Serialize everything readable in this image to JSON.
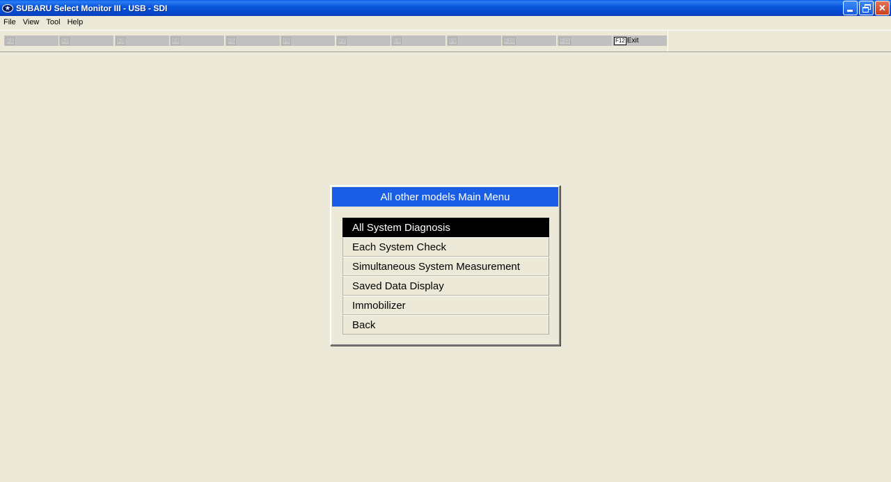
{
  "window": {
    "title": "SUBARU Select Monitor III - USB - SDI",
    "app_icon": "subaru-logo-icon",
    "controls": {
      "minimize_icon": "minimize-icon",
      "restore_icon": "restore-icon",
      "close_icon": "close-icon",
      "close_glyph": "✕"
    }
  },
  "menubar": {
    "items": [
      "File",
      "View",
      "Tool",
      "Help"
    ]
  },
  "toolbar": {
    "fkeys": [
      {
        "key": "F1",
        "label": ""
      },
      {
        "key": "F2",
        "label": ""
      },
      {
        "key": "F3",
        "label": ""
      },
      {
        "key": "F4",
        "label": ""
      },
      {
        "key": "F5",
        "label": ""
      },
      {
        "key": "F6",
        "label": ""
      },
      {
        "key": "F7",
        "label": ""
      },
      {
        "key": "F8",
        "label": ""
      },
      {
        "key": "F9",
        "label": ""
      },
      {
        "key": "F10",
        "label": ""
      },
      {
        "key": "F11",
        "label": ""
      },
      {
        "key": "F12",
        "label": "Exit"
      }
    ]
  },
  "dialog": {
    "title": "All other models Main Menu",
    "items": [
      {
        "label": "All System Diagnosis",
        "selected": true
      },
      {
        "label": "Each System Check",
        "selected": false
      },
      {
        "label": "Simultaneous System Measurement",
        "selected": false
      },
      {
        "label": "Saved Data Display",
        "selected": false
      },
      {
        "label": "Immobilizer",
        "selected": false
      },
      {
        "label": "Back",
        "selected": false
      }
    ]
  },
  "colors": {
    "titlebar": "#0a57dc",
    "dialog_title": "#1a5ee6",
    "selected_row": "#000000",
    "background": "#ece9d8"
  }
}
